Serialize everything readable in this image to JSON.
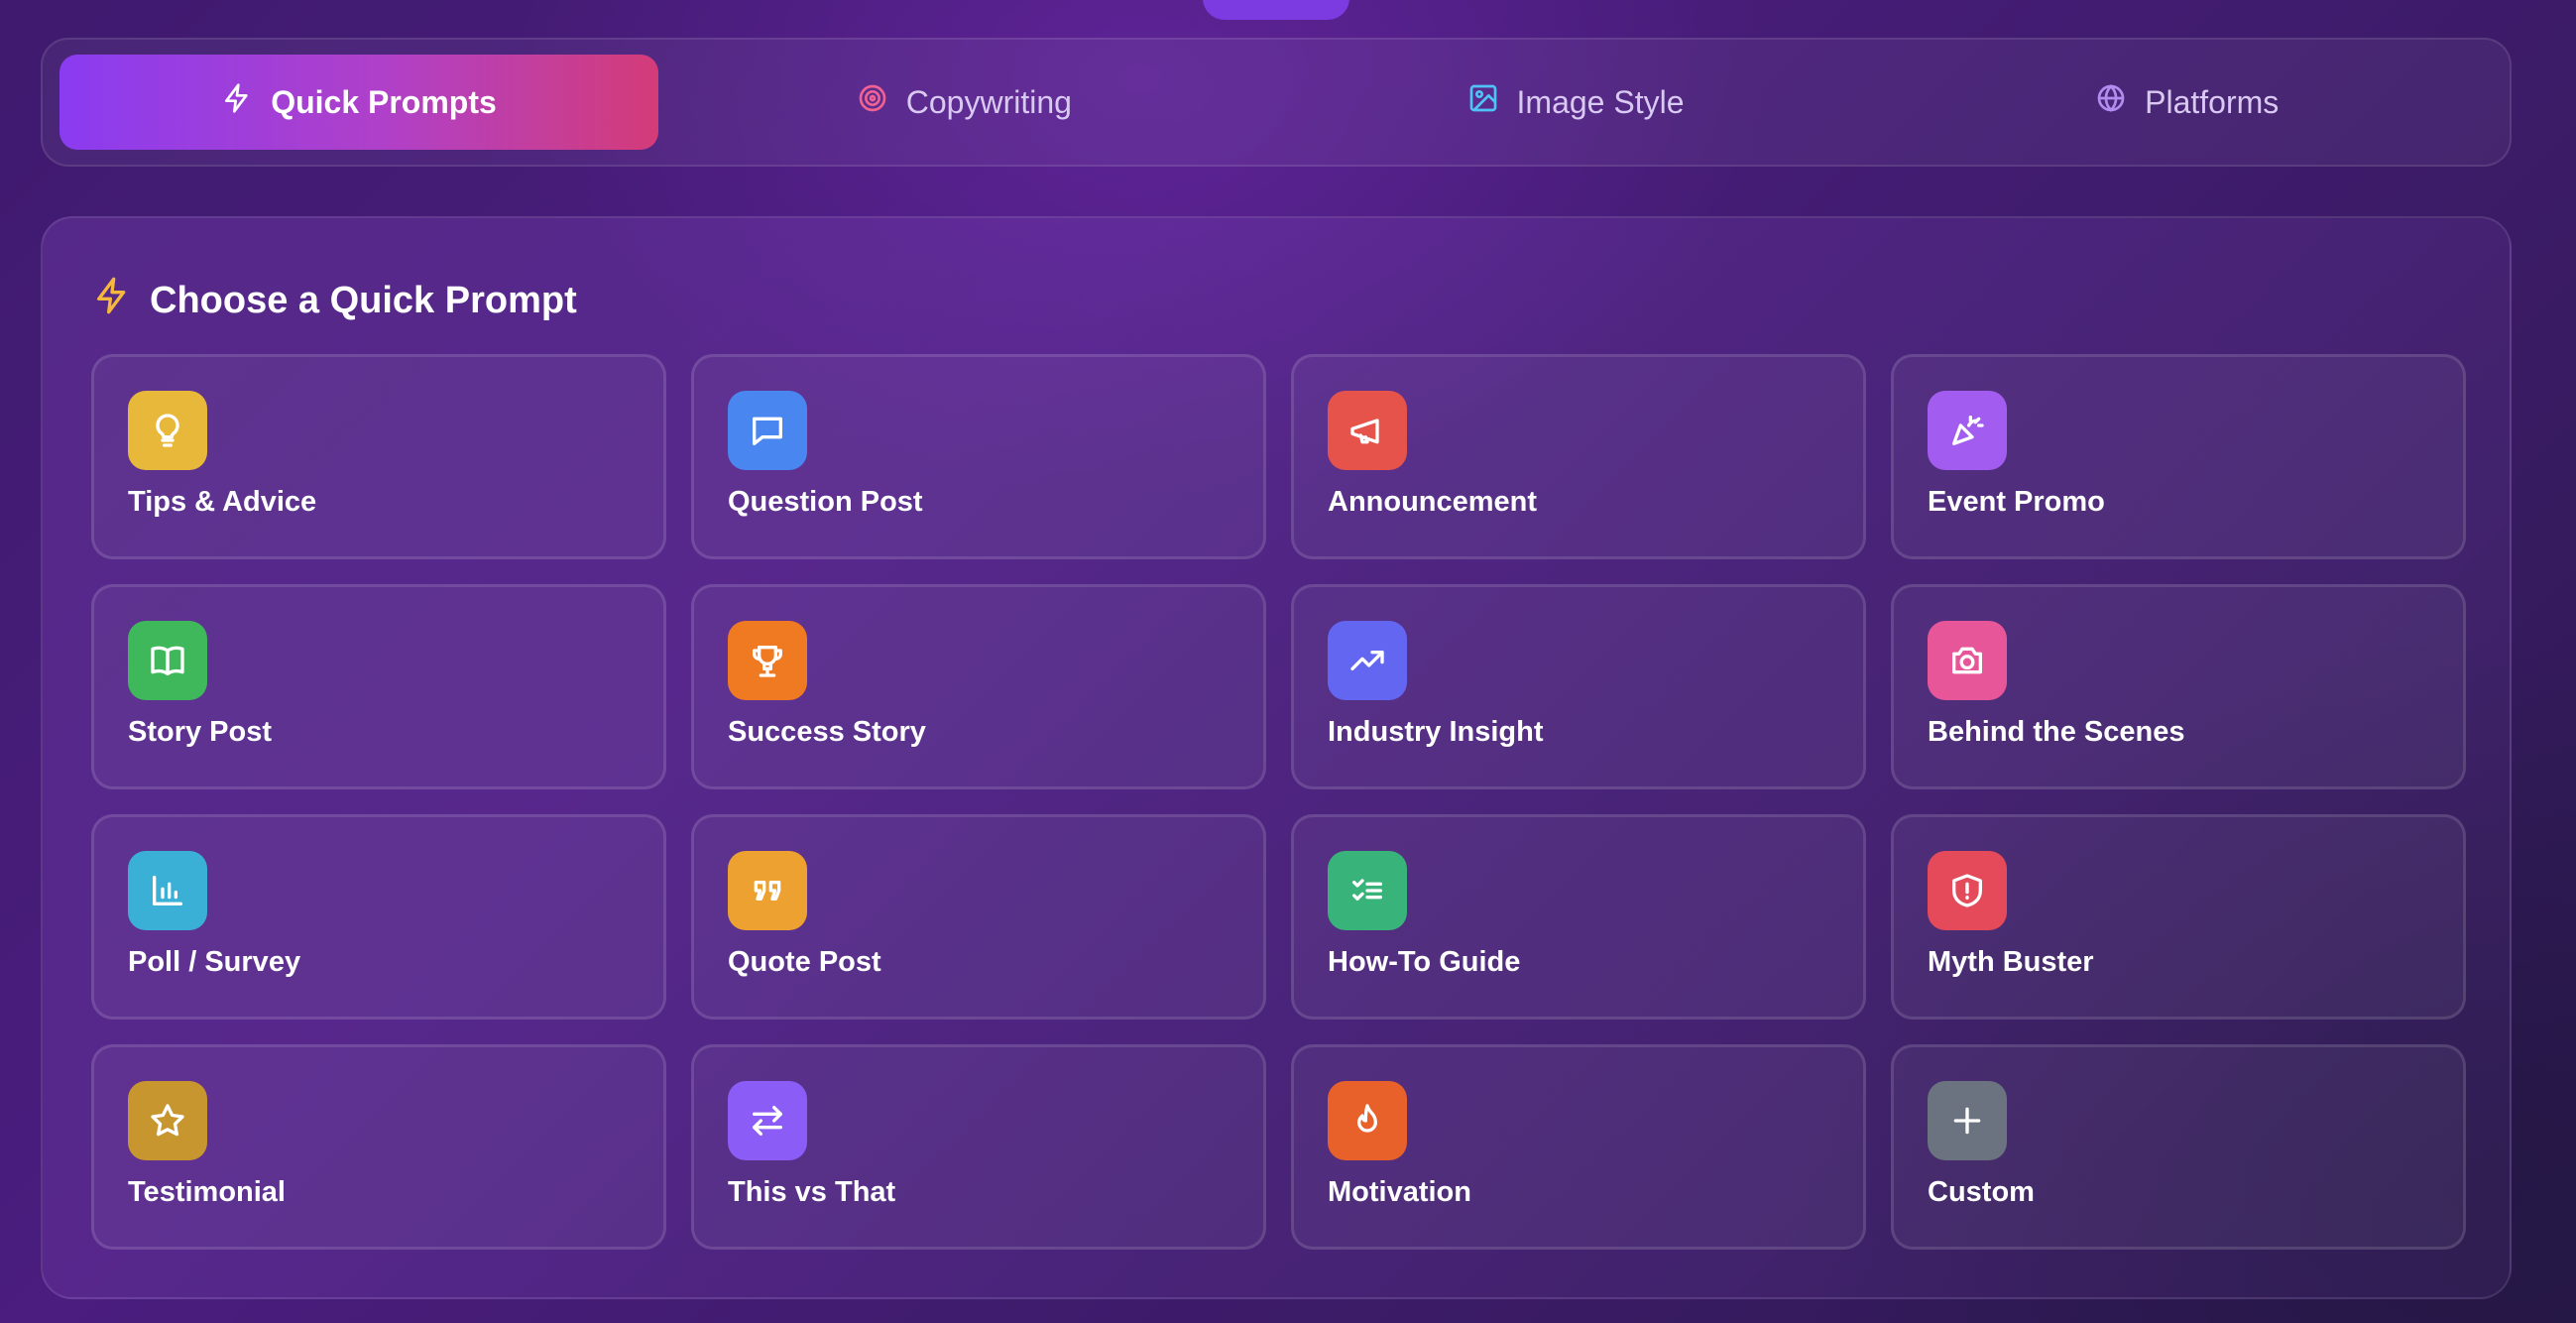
{
  "tabs": [
    {
      "label": "Quick Prompts",
      "icon": "lightning-icon",
      "active": true
    },
    {
      "label": "Copywriting",
      "icon": "target-icon",
      "active": false
    },
    {
      "label": "Image Style",
      "icon": "image-icon",
      "active": false
    },
    {
      "label": "Platforms",
      "icon": "globe-icon",
      "active": false
    }
  ],
  "panel": {
    "title": "Choose a Quick Prompt",
    "title_icon": "lightning-icon"
  },
  "prompts": [
    {
      "label": "Tips & Advice",
      "icon": "lightbulb-icon",
      "color": "#e8b83a"
    },
    {
      "label": "Question Post",
      "icon": "chat-bubble-icon",
      "color": "#4a86f0"
    },
    {
      "label": "Announcement",
      "icon": "megaphone-icon",
      "color": "#e5534b"
    },
    {
      "label": "Event Promo",
      "icon": "party-popper-icon",
      "color": "#a35cf0"
    },
    {
      "label": "Story Post",
      "icon": "open-book-icon",
      "color": "#3fb85c"
    },
    {
      "label": "Success Story",
      "icon": "trophy-icon",
      "color": "#f07a22"
    },
    {
      "label": "Industry Insight",
      "icon": "trending-up-icon",
      "color": "#6366f1"
    },
    {
      "label": "Behind the Scenes",
      "icon": "camera-icon",
      "color": "#e8569a"
    },
    {
      "label": "Poll / Survey",
      "icon": "bar-chart-icon",
      "color": "#3bb0d6"
    },
    {
      "label": "Quote Post",
      "icon": "quote-icon",
      "color": "#eca131"
    },
    {
      "label": "How-To Guide",
      "icon": "checklist-icon",
      "color": "#38b47a"
    },
    {
      "label": "Myth Buster",
      "icon": "shield-alert-icon",
      "color": "#e54a5a"
    },
    {
      "label": "Testimonial",
      "icon": "star-icon",
      "color": "#c8962e"
    },
    {
      "label": "This vs That",
      "icon": "swap-arrows-icon",
      "color": "#8b5cf6"
    },
    {
      "label": "Motivation",
      "icon": "flame-icon",
      "color": "#e8602a"
    },
    {
      "label": "Custom",
      "icon": "plus-icon",
      "color": "#6b7280"
    }
  ]
}
